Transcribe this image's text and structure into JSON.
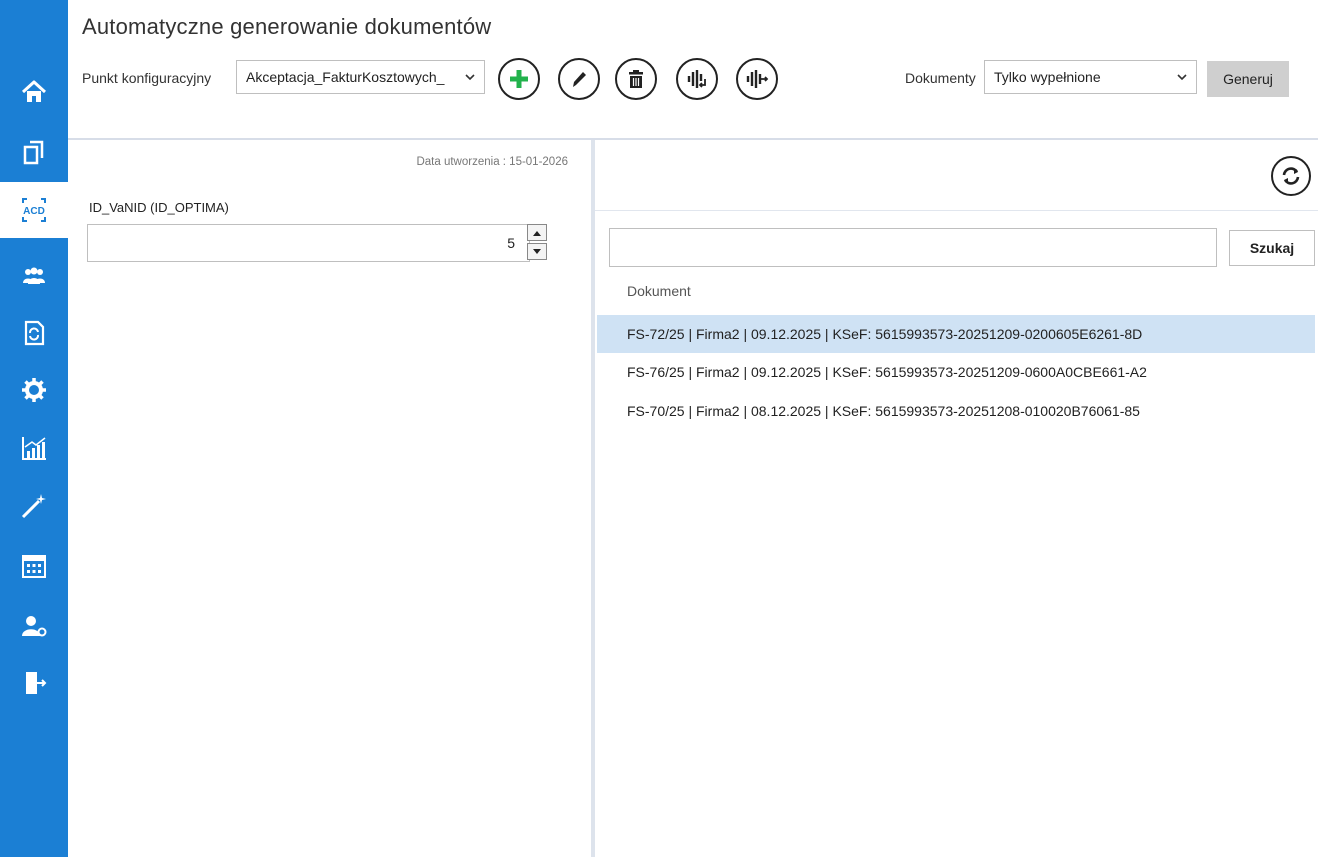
{
  "header": {
    "title": "Automatyczne generowanie dokumentów",
    "config_label": "Punkt konfiguracyjny",
    "config_value": "Akceptacja_FakturKosztowych_",
    "docs_label": "Dokumenty",
    "docs_value": "Tylko wypełnione",
    "generate_label": "Generuj"
  },
  "left_panel": {
    "created": "Data utworzenia : 15-01-2026",
    "field_label": "ID_VaNID (ID_OPTIMA)",
    "field_value": "5"
  },
  "right_panel": {
    "search_label": "Szukaj",
    "column_header": "Dokument",
    "rows": [
      "FS-72/25 | Firma2 | 09.12.2025 | KSeF: 5615993573-20251209-0200605E6261-8D",
      "FS-76/25 | Firma2 | 09.12.2025 | KSeF: 5615993573-20251209-0600A0CBE661-A2",
      "FS-70/25 | Firma2 | 08.12.2025 | KSeF: 5615993573-20251208-010020B76061-85"
    ]
  },
  "sidebar": {
    "acd_text": "ACD"
  },
  "colors": {
    "sidebar": "#1b7fd4",
    "selected_row": "#cfe2f4",
    "add_icon": "#22b24c"
  }
}
